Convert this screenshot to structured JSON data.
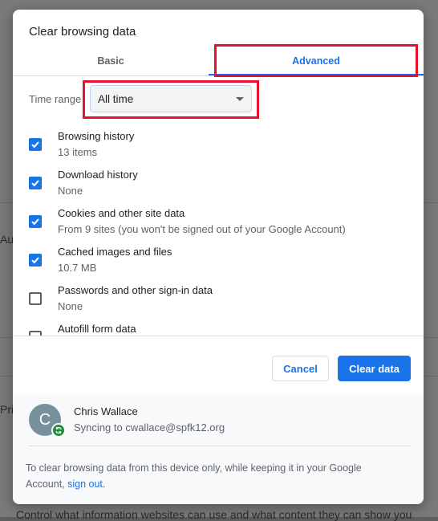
{
  "background": {
    "fragment_1": "Au",
    "fragment_2": "Pri",
    "bottom_line": "Control what information websites can use and what content they can show you"
  },
  "dialog": {
    "title": "Clear browsing data",
    "tabs": [
      {
        "label": "Basic",
        "selected": false
      },
      {
        "label": "Advanced",
        "selected": true
      }
    ],
    "time_range": {
      "label": "Time range",
      "value": "All time"
    },
    "items": [
      {
        "label": "Browsing history",
        "sub": "13 items",
        "checked": true
      },
      {
        "label": "Download history",
        "sub": "None",
        "checked": true
      },
      {
        "label": "Cookies and other site data",
        "sub": "From 9 sites (you won't be signed out of your Google Account)",
        "checked": true
      },
      {
        "label": "Cached images and files",
        "sub": "10.7 MB",
        "checked": true
      },
      {
        "label": "Passwords and other sign-in data",
        "sub": "None",
        "checked": false
      },
      {
        "label": "Autofill form data",
        "sub": "",
        "checked": false
      }
    ],
    "buttons": {
      "cancel": "Cancel",
      "clear": "Clear data"
    },
    "account": {
      "initial": "C",
      "name": "Chris Wallace",
      "sync": "Syncing to cwallace@spfk12.org"
    },
    "note": {
      "text_before": "To clear browsing data from this device only, while keeping it in your Google Account, ",
      "link": "sign out",
      "text_after": "."
    }
  },
  "colors": {
    "accent": "#1a73e8",
    "highlight": "#e8112d",
    "sync_badge": "#1e8e3e"
  }
}
